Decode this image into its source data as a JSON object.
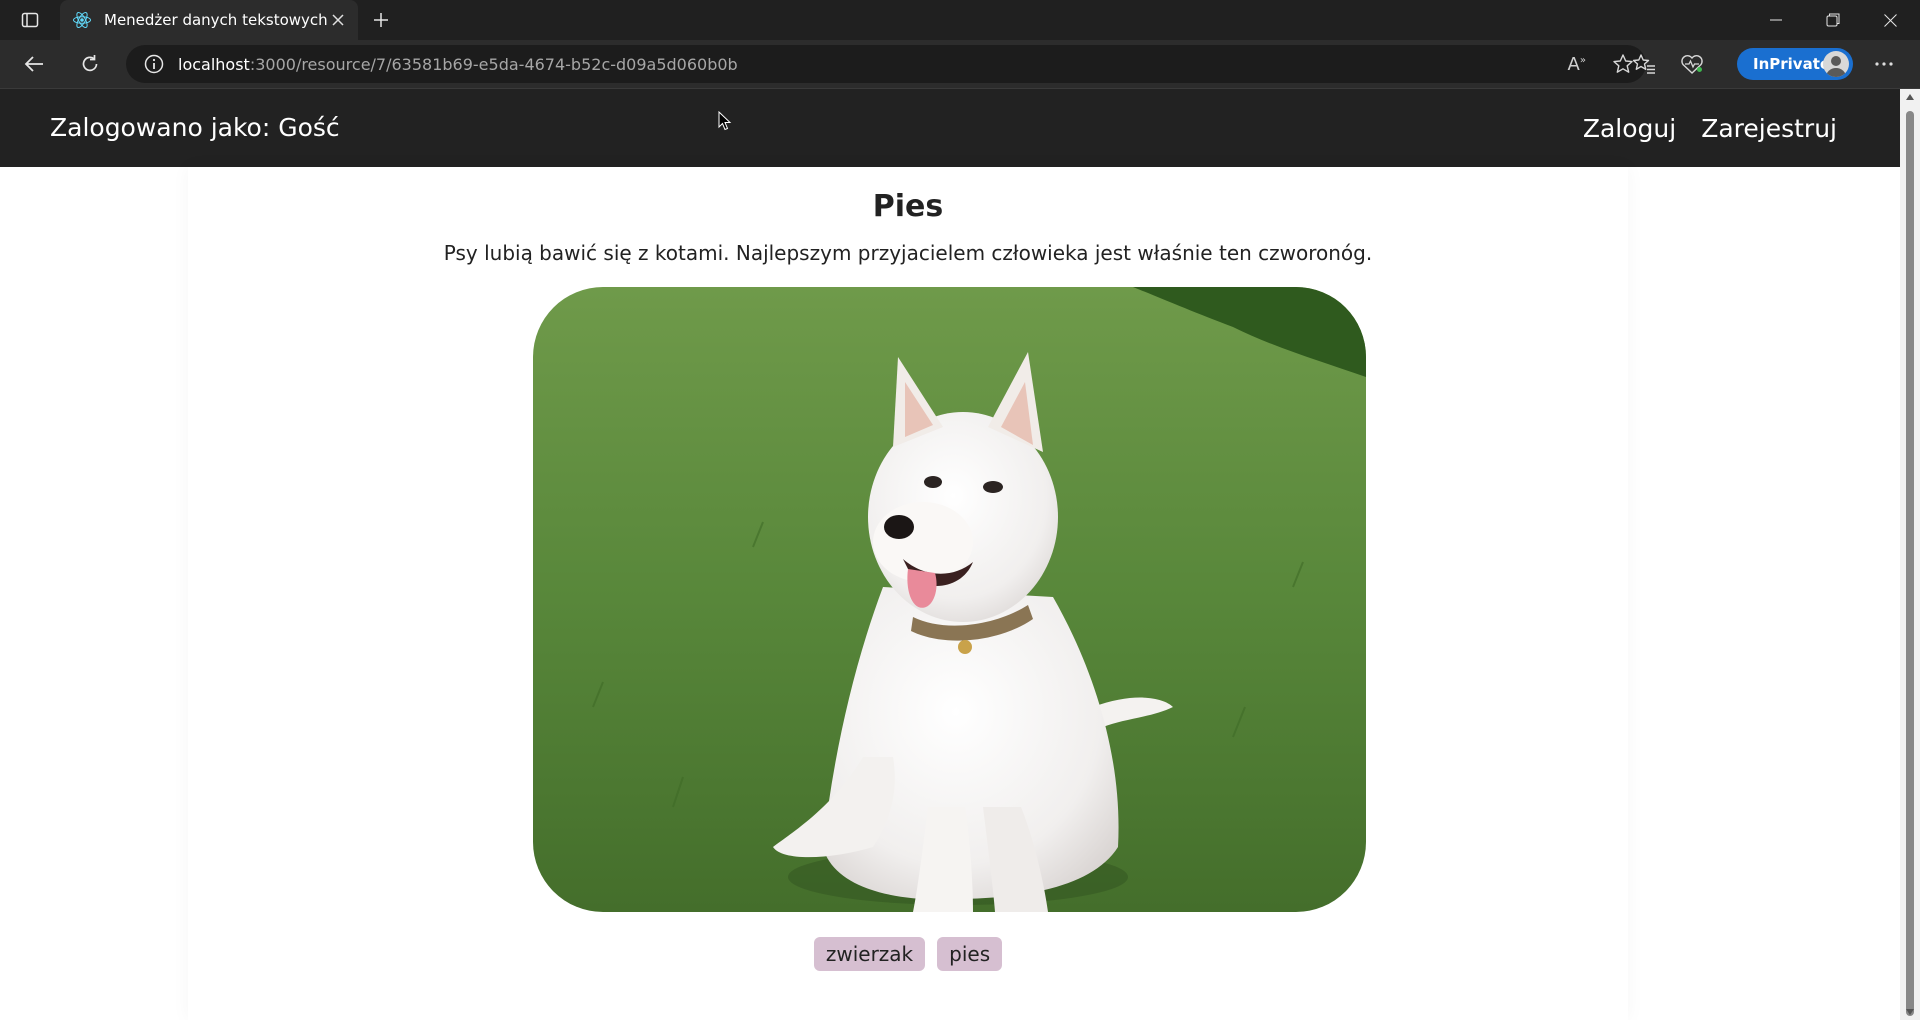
{
  "browser": {
    "tab_title": "Menedżer danych tekstowych",
    "url_host": "localhost",
    "url_path": ":3000/resource/7/63581b69-e5da-4674-b52c-d09a5d060b0b",
    "inprivate_label": "InPrivate",
    "accent": "#1a6fd0"
  },
  "app": {
    "user_label": "Zalogowano jako: Gość",
    "login_label": "Zaloguj",
    "register_label": "Zarejestruj"
  },
  "resource": {
    "title": "Pies",
    "description": "Psy lubią bawić się z kotami. Najlepszym przyjacielem człowieka jest właśnie ten czworonóg.",
    "image_subject": "white-puppy-on-grass",
    "tags": [
      "zwierzak",
      "pies"
    ],
    "tag_color": "#d6bfd1"
  }
}
